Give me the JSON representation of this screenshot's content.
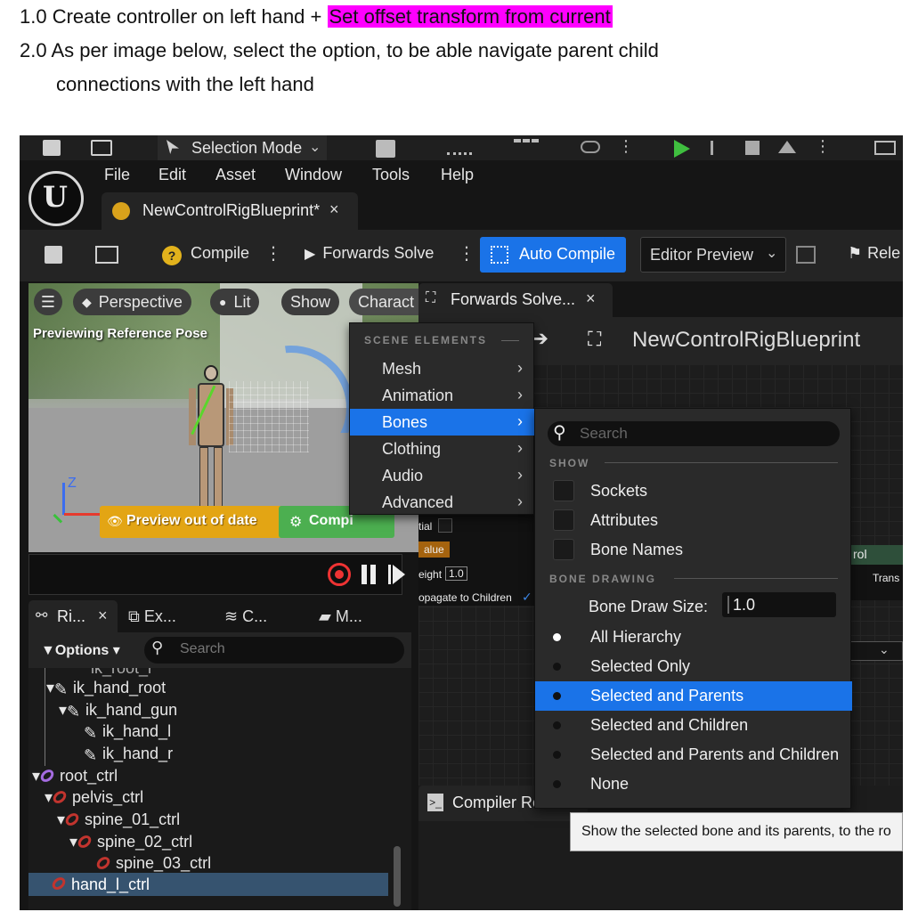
{
  "instructions": {
    "line1_prefix": "1.0 Create controller on left hand + ",
    "line1_highlight": "Set offset transform from current",
    "line2": "2.0  As per image below, select the option, to be able navigate parent child",
    "line3": "connections with the left hand"
  },
  "topbar": {
    "mode": "Selection Mode"
  },
  "menu": {
    "items": [
      "File",
      "Edit",
      "Asset",
      "Window",
      "Tools",
      "Help"
    ]
  },
  "asset_tab": {
    "label": "NewControlRigBlueprint*"
  },
  "toolbar": {
    "compile": "Compile",
    "forwards_solve": "Forwards Solve",
    "auto_compile": "Auto Compile",
    "editor_preview": "Editor Preview",
    "release": "Rele"
  },
  "viewport": {
    "perspective": "Perspective",
    "lit": "Lit",
    "show": "Show",
    "character": "Charact",
    "previewing": "Previewing Reference Pose",
    "out_of_date": "Preview out of date",
    "compile_btn": "Compi"
  },
  "graph": {
    "tab": "Forwards Solve...",
    "breadcrumb": "NewControlRigBlueprint",
    "compiler_results": "Compiler Re",
    "node_initial": "tial",
    "node_value": "alue",
    "node_weight": "eight",
    "node_weight_val": "1.0",
    "node_propagate": "opagate to Children",
    "node_rol": "rol",
    "node_trans": "Trans"
  },
  "context_menu": {
    "header": "SCENE ELEMENTS",
    "items": [
      "Mesh",
      "Animation",
      "Bones",
      "Clothing",
      "Audio",
      "Advanced"
    ]
  },
  "bones_submenu": {
    "search_placeholder": "Search",
    "show_header": "SHOW",
    "show_items": [
      "Sockets",
      "Attributes",
      "Bone Names"
    ],
    "drawing_header": "BONE DRAWING",
    "draw_size_label": "Bone Draw Size:",
    "draw_size_value": "1.0",
    "options": [
      "All Hierarchy",
      "Selected Only",
      "Selected and Parents",
      "Selected and Children",
      "Selected and Parents and Children",
      "None"
    ],
    "selected_option": "Selected and Parents",
    "active_option": "All Hierarchy"
  },
  "tooltip": {
    "text": "Show the selected bone and its parents, to the ro"
  },
  "hierarchy": {
    "tabs": [
      "Ri...",
      "Ex...",
      "C...",
      "M..."
    ],
    "options": "Options",
    "search_placeholder": "Search",
    "rows": [
      "ik_hand_root",
      "ik_hand_gun",
      "ik_hand_l",
      "ik_hand_r",
      "root_ctrl",
      "pelvis_ctrl",
      "spine_01_ctrl",
      "spine_02_ctrl",
      "spine_03_ctrl",
      "hand_l_ctrl"
    ],
    "cut_row": "ik_root_l"
  },
  "colors": {
    "highlight": "#ff00ff",
    "accent_blue": "#1a73e8",
    "warning_yellow": "#e3a514",
    "compile_green": "#4caf50"
  }
}
